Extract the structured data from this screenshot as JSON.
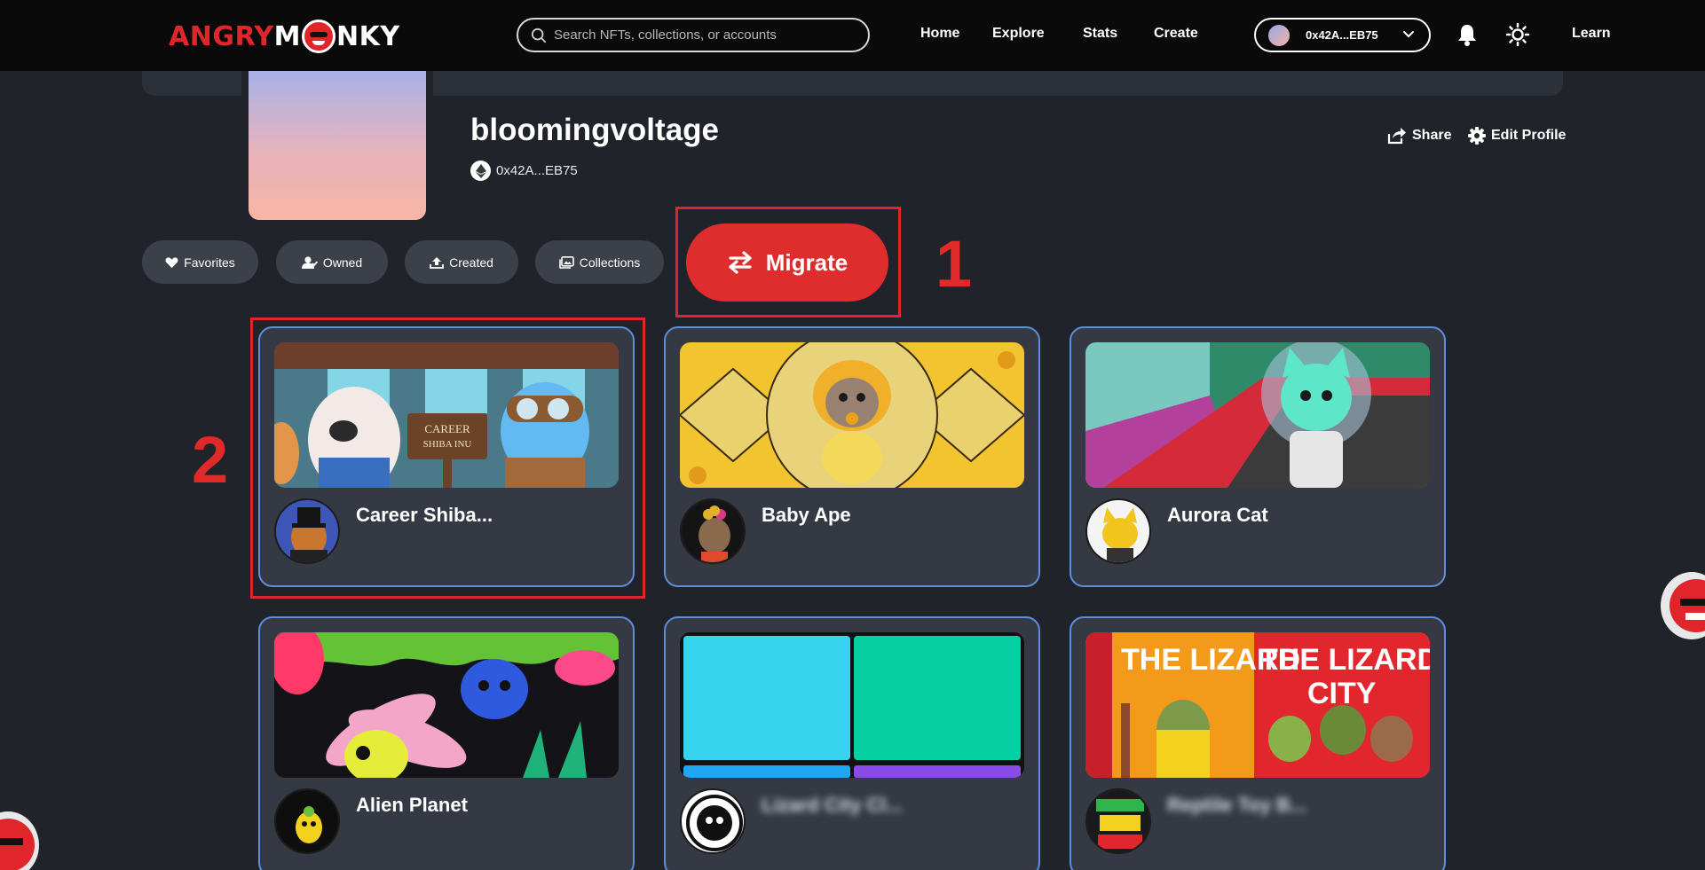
{
  "nav": {
    "logo_part1": "ANGRY",
    "logo_part2": "NKY",
    "search_placeholder": "Search NFTs, collections, or accounts",
    "links": [
      "Home",
      "Explore",
      "Stats",
      "Create"
    ],
    "wallet_address": "0x42A...EB75",
    "learn_label": "Learn",
    "icons": {
      "search": "search-icon",
      "bell": "bell-icon",
      "theme": "sun-icon",
      "wallet_menu": "chevron-down-icon"
    }
  },
  "profile": {
    "username": "bloomingvoltage",
    "address": "0x42A...EB75",
    "share_label": "Share",
    "edit_label": "Edit Profile"
  },
  "filters": [
    {
      "label": "Favorites",
      "icon": "heart-icon"
    },
    {
      "label": "Owned",
      "icon": "user-icon"
    },
    {
      "label": "Created",
      "icon": "upload-icon"
    },
    {
      "label": "Collections",
      "icon": "image-stack-icon"
    }
  ],
  "migrate": {
    "label": "Migrate",
    "icon": "swap-arrows-icon"
  },
  "annotations": {
    "step1": "1",
    "step2": "2"
  },
  "cards": [
    {
      "name": "Career Shiba...",
      "blurred": false
    },
    {
      "name": "Baby Ape",
      "blurred": false
    },
    {
      "name": "Aurora Cat",
      "blurred": false
    },
    {
      "name": "Alien Planet",
      "blurred": false
    },
    {
      "name": "Lizard City Cl...",
      "blurred": true
    },
    {
      "name": "Reptile Toy B...",
      "blurred": true
    }
  ],
  "colors": {
    "brand_red": "#e0262b",
    "background": "#202329",
    "card": "#343944",
    "card_border": "#5b8fdc",
    "chip": "#3b4049"
  }
}
